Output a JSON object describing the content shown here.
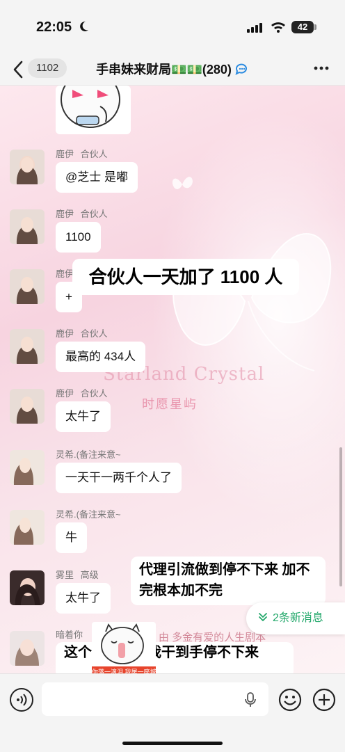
{
  "status_bar": {
    "time": "22:05",
    "battery": "42"
  },
  "nav": {
    "back_count": "1102",
    "title": "手串妹来财局💵💵(280)"
  },
  "chat": {
    "watermark_en": "Starland Crystal",
    "watermark_cn": "时愿星屿",
    "watermark_tag": "由 多金有爱的人生剧本",
    "messages": [
      {
        "sender": "鹿伊",
        "role": "合伙人",
        "text": "@芝士 是嘟"
      },
      {
        "sender": "鹿伊",
        "role": "合伙人",
        "text": "1100"
      },
      {
        "sender": "鹿伊",
        "role": "",
        "text": "+"
      },
      {
        "sender": "鹿伊",
        "role": "合伙人",
        "text": "最高的  434人"
      },
      {
        "sender": "鹿伊",
        "role": "合伙人",
        "text": "太牛了"
      },
      {
        "sender": "灵希.(备注来意~",
        "role": "",
        "text": "一天干一两千个人了"
      },
      {
        "sender": "灵希.(备注来意~",
        "role": "",
        "text": "牛"
      },
      {
        "sender": "雾里",
        "role": "高级",
        "text": "太牛了"
      },
      {
        "sender": "暗着你",
        "role": "",
        "text": ""
      }
    ],
    "captions": {
      "c1": "合伙人一天加了 1100 人",
      "c2": "代理引流做到停不下来 加不完根本加不完",
      "c3": "这个…真的给我干到手停不下来"
    },
    "new_messages": "2条新消息",
    "meme_caption": "你落一滴泪 我屠一座城!"
  }
}
